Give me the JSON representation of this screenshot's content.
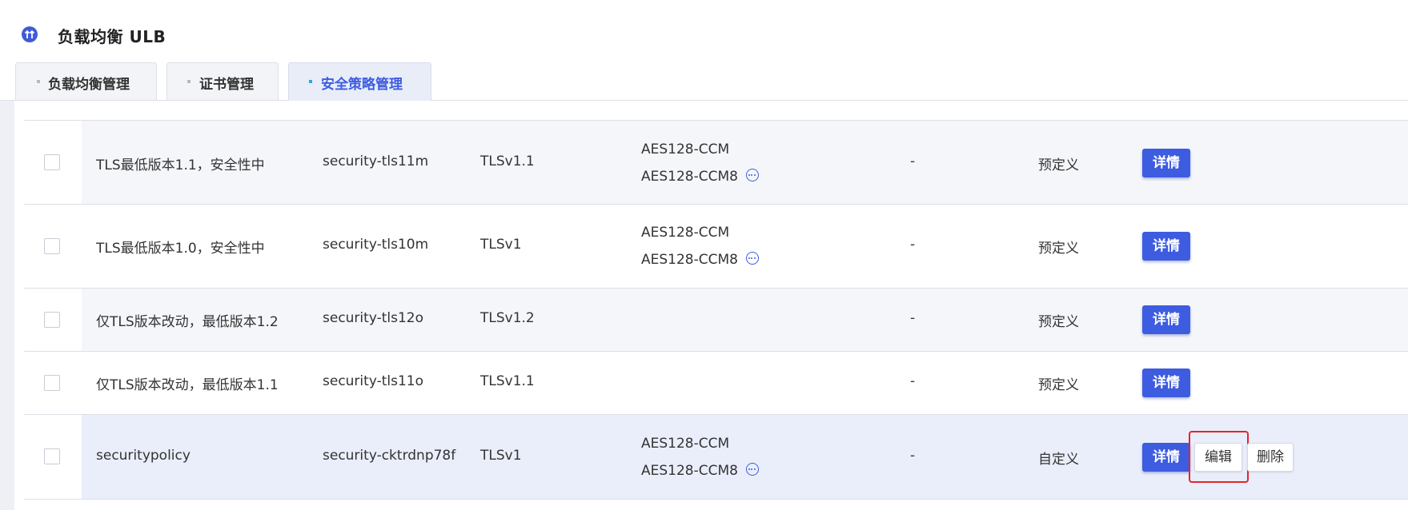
{
  "header": {
    "title": "负载均衡 ULB",
    "logo_icon": "double-arrow-up-icon"
  },
  "tabs": [
    {
      "label": "负载均衡管理",
      "active": false
    },
    {
      "label": "证书管理",
      "active": false
    },
    {
      "label": "安全策略管理",
      "active": true
    }
  ],
  "rows": [
    {
      "name": "TLS最低版本1.1，安全性中",
      "id": "security-tls11m",
      "version": "TLSv1.1",
      "ciphers": [
        "AES128-CCM",
        "AES128-CCM8"
      ],
      "extra": "-",
      "type": "预定义",
      "detail_label": "详情",
      "checked": false
    },
    {
      "name": "TLS最低版本1.0，安全性中",
      "id": "security-tls10m",
      "version": "TLSv1",
      "ciphers": [
        "AES128-CCM",
        "AES128-CCM8"
      ],
      "extra": "-",
      "type": "预定义",
      "detail_label": "详情",
      "checked": false
    },
    {
      "name": "仅TLS版本改动，最低版本1.2",
      "id": "security-tls12o",
      "version": "TLSv1.2",
      "ciphers": [],
      "extra": "-",
      "type": "预定义",
      "detail_label": "详情",
      "checked": false
    },
    {
      "name": "仅TLS版本改动，最低版本1.1",
      "id": "security-tls11o",
      "version": "TLSv1.1",
      "ciphers": [],
      "extra": "-",
      "type": "预定义",
      "detail_label": "详情",
      "checked": false
    },
    {
      "name": "securitypolicy",
      "id": "security-cktrdnp78f",
      "version": "TLSv1",
      "ciphers": [
        "AES128-CCM",
        "AES128-CCM8"
      ],
      "extra": "-",
      "type": "自定义",
      "detail_label": "详情",
      "edit_label": "编辑",
      "delete_label": "删除",
      "checked": false
    }
  ],
  "colors": {
    "accent": "#3d5ce0",
    "highlight_border": "#e5242b"
  }
}
